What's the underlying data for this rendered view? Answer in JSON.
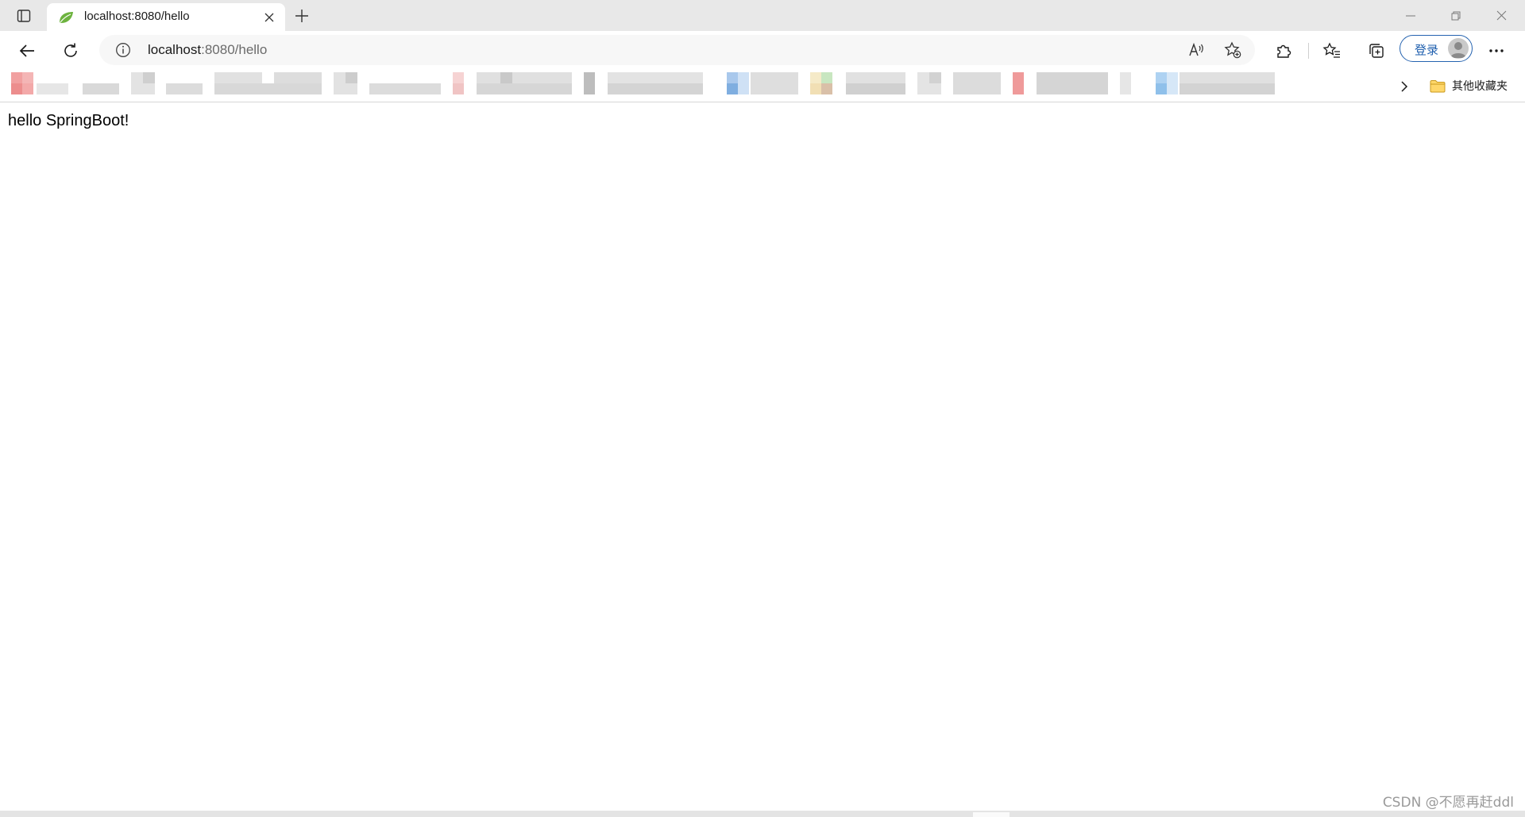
{
  "tab": {
    "title": "localhost:8080/hello",
    "favicon": "spring-leaf-icon",
    "favicon_color": "#6db33f"
  },
  "address": {
    "host": "localhost",
    "rest": ":8080/hello"
  },
  "toolbar": {
    "signin_label": "登录"
  },
  "bookmarks": {
    "other_favorites_label": "其他收藏夹"
  },
  "page": {
    "text": "hello SpringBoot!"
  },
  "watermark": "CSDN @不愿再赶ddl",
  "colors": {
    "accent": "#2563b0",
    "tabstrip_bg": "#e8e8e8",
    "address_bg": "#f7f7f7"
  }
}
